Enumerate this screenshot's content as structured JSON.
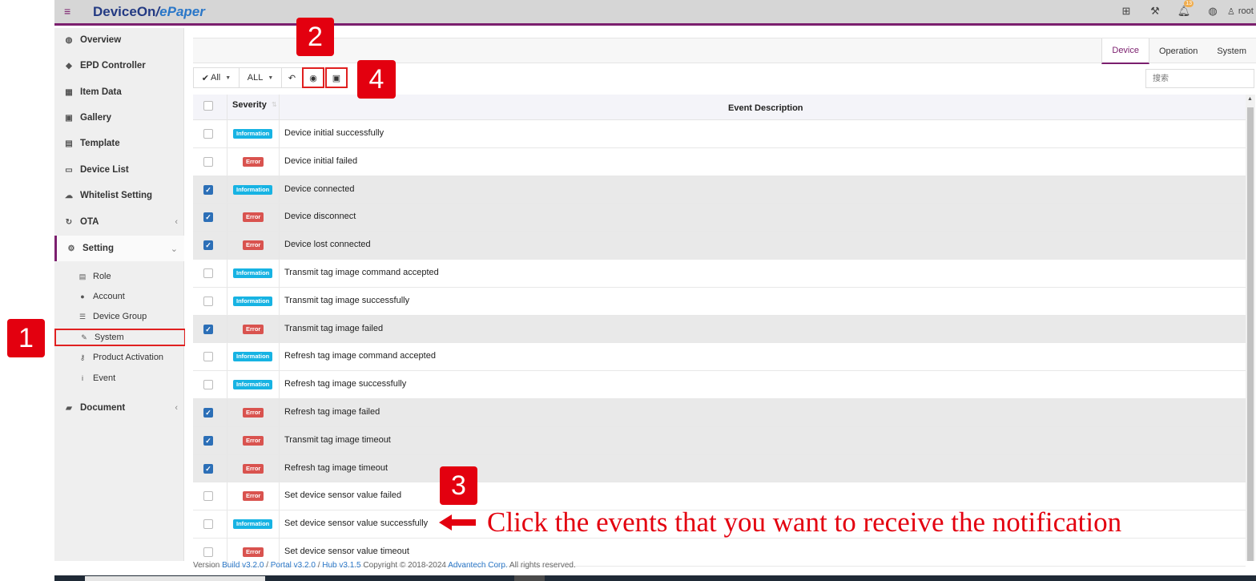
{
  "app": {
    "brand_main": "DeviceOn",
    "brand_sep": "/",
    "brand_sub": "ePaper",
    "notification_count": "13",
    "user": "root"
  },
  "sidebar": {
    "items": [
      {
        "label": "Overview",
        "icon": "globe-icon"
      },
      {
        "label": "EPD Controller",
        "icon": "tag-icon"
      },
      {
        "label": "Item Data",
        "icon": "table-icon"
      },
      {
        "label": "Gallery",
        "icon": "image-icon"
      },
      {
        "label": "Template",
        "icon": "template-icon"
      },
      {
        "label": "Device List",
        "icon": "monitor-icon"
      },
      {
        "label": "Whitelist Setting",
        "icon": "cloud-icon"
      },
      {
        "label": "OTA",
        "icon": "refresh-icon"
      },
      {
        "label": "Setting",
        "icon": "gears-icon"
      },
      {
        "label": "Document",
        "icon": "book-icon"
      }
    ],
    "sub_items": [
      {
        "label": "Role",
        "icon": "id-card-icon"
      },
      {
        "label": "Account",
        "icon": "user-icon"
      },
      {
        "label": "Device Group",
        "icon": "list-icon"
      },
      {
        "label": "System",
        "icon": "wrench-icon"
      },
      {
        "label": "Product Activation",
        "icon": "key-icon"
      },
      {
        "label": "Event",
        "icon": "info-icon"
      }
    ]
  },
  "tabs": [
    "Device",
    "Operation",
    "System"
  ],
  "toolbar": {
    "filter_all": "All",
    "filter_severity": "ALL",
    "search_placeholder": "搜索"
  },
  "table": {
    "headers": {
      "severity": "Severity",
      "description": "Event Description"
    },
    "rows": [
      {
        "checked": false,
        "severity": "Information",
        "description": "Device initial successfully"
      },
      {
        "checked": false,
        "severity": "Error",
        "description": "Device initial failed"
      },
      {
        "checked": true,
        "severity": "Information",
        "description": "Device connected"
      },
      {
        "checked": true,
        "severity": "Error",
        "description": "Device disconnect"
      },
      {
        "checked": true,
        "severity": "Error",
        "description": "Device lost connected"
      },
      {
        "checked": false,
        "severity": "Information",
        "description": "Transmit tag image command accepted"
      },
      {
        "checked": false,
        "severity": "Information",
        "description": "Transmit tag image successfully"
      },
      {
        "checked": true,
        "severity": "Error",
        "description": "Transmit tag image failed"
      },
      {
        "checked": false,
        "severity": "Information",
        "description": "Refresh tag image command accepted"
      },
      {
        "checked": false,
        "severity": "Information",
        "description": "Refresh tag image successfully"
      },
      {
        "checked": true,
        "severity": "Error",
        "description": "Refresh tag image failed"
      },
      {
        "checked": true,
        "severity": "Error",
        "description": "Transmit tag image timeout"
      },
      {
        "checked": true,
        "severity": "Error",
        "description": "Refresh tag image timeout"
      },
      {
        "checked": false,
        "severity": "Error",
        "description": "Set device sensor value failed"
      },
      {
        "checked": false,
        "severity": "Information",
        "description": "Set device sensor value successfully"
      },
      {
        "checked": false,
        "severity": "Error",
        "description": "Set device sensor value timeout"
      }
    ]
  },
  "footer": {
    "prefix": "Version",
    "build": "Build v3.2.0",
    "sep1": "/",
    "portal": "Portal v3.2.0",
    "sep2": "/",
    "hub": "Hub v3.1.5",
    "copyright": "Copyright © 2018-2024",
    "company": "Advantech Corp.",
    "rights": "All rights reserved."
  },
  "annotations": {
    "callout_1": "1",
    "callout_2": "2",
    "callout_3": "3",
    "callout_4": "4",
    "instruction": "Click the events that you want to receive the notification"
  },
  "colors": {
    "accent": "#7b1f6e",
    "info_badge": "#17b3e3",
    "error_badge": "#d9534f",
    "checkbox": "#2c6fb7",
    "annotation_red": "#e3000f"
  }
}
